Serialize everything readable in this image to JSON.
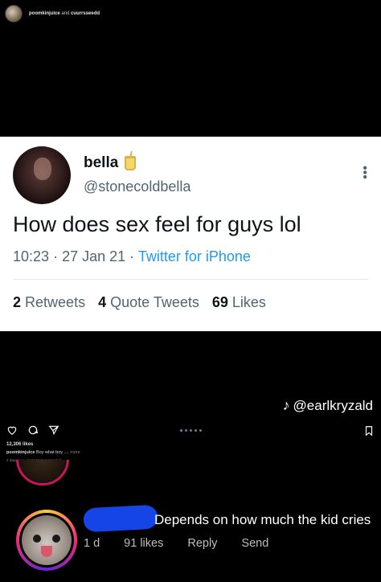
{
  "post_header": {
    "user1": "poomkinjuice",
    "and_word": "and",
    "user2": "cuurrsseedd"
  },
  "tweet": {
    "name": "bella",
    "handle": "@stonecoldbella",
    "text": "How does sex feel for guys lol",
    "time": "10:23",
    "date": "27 Jan 21",
    "source": "Twitter for iPhone",
    "separator": "·",
    "retweets_count": "2",
    "retweets_label": "Retweets",
    "quotes_count": "4",
    "quotes_label": "Quote Tweets",
    "likes_count": "69",
    "likes_label": "Likes"
  },
  "tiktok": {
    "handle": "@earlkryzald"
  },
  "instagram_post": {
    "likes": "12,306 likes",
    "caption_user": "poomkinjuice",
    "caption_text": "Boy what boy ....",
    "caption_more": "more",
    "ago": "2 days ago · Instagram suggested"
  },
  "comment": {
    "text": "Depends on how much the kid cries",
    "age": "1 d",
    "likes": "91 likes",
    "reply": "Reply",
    "send": "Send"
  },
  "icons": [
    "heart-icon",
    "comment-icon",
    "share-icon",
    "bookmark-icon",
    "more-icon",
    "tiktok-icon",
    "juice-emoji-icon"
  ],
  "colors": {
    "tweet_bg": "#ffffff",
    "twitter_blue": "#1d9bf0",
    "muted_text": "#536471",
    "redaction_blue": "#1545e6"
  }
}
